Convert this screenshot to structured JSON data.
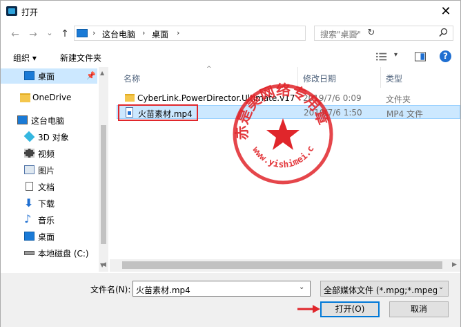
{
  "window": {
    "title": "打开",
    "close": "✕"
  },
  "nav": {
    "back": "←",
    "forward": "→",
    "recent": "⌄",
    "up": "↑",
    "breadcrumb": [
      "这台电脑",
      "桌面"
    ],
    "separator": "›",
    "refresh": "↻",
    "search_placeholder": "搜索\"桌面\""
  },
  "toolbar": {
    "organize": "组织 ▾",
    "new_folder": "新建文件夹",
    "view_menu": "▾"
  },
  "sidebar": {
    "items": [
      {
        "label": "桌面",
        "icon": "desktop-icon"
      },
      {
        "label": "OneDrive",
        "icon": "folder-icon"
      },
      {
        "label": "这台电脑",
        "icon": "computer-icon"
      },
      {
        "label": "3D 对象",
        "icon": "3d-objects-icon"
      },
      {
        "label": "视频",
        "icon": "video-icon"
      },
      {
        "label": "图片",
        "icon": "pictures-icon"
      },
      {
        "label": "文档",
        "icon": "documents-icon"
      },
      {
        "label": "下载",
        "icon": "download-icon"
      },
      {
        "label": "音乐",
        "icon": "music-icon"
      },
      {
        "label": "桌面",
        "icon": "desktop-icon"
      },
      {
        "label": "本地磁盘 (C:)",
        "icon": "drive-icon"
      }
    ]
  },
  "columns": {
    "name": "名称",
    "date": "修改日期",
    "type": "类型"
  },
  "files": [
    {
      "name": "CyberLink.PowerDirector.Ultimate.v17",
      "date": "2019/7/6 0:09",
      "type": "文件夹"
    },
    {
      "name": "火苗素材.mp4",
      "date": "2019/7/6 1:50",
      "type": "MP4 文件"
    }
  ],
  "stamp": {
    "text": "赤是美网络专用章",
    "url": "www.yishimei.cn"
  },
  "footer": {
    "filename_label": "文件名(N):",
    "filename_value": "火苗素材.mp4",
    "filetype_value": "全部媒体文件 (*.mpg;*.mpeg;",
    "open_button": "打开(O)",
    "cancel_button": "取消"
  },
  "colors": {
    "accent": "#0078d7",
    "selection": "#cce8ff",
    "stamp_red": "#e0262b"
  }
}
